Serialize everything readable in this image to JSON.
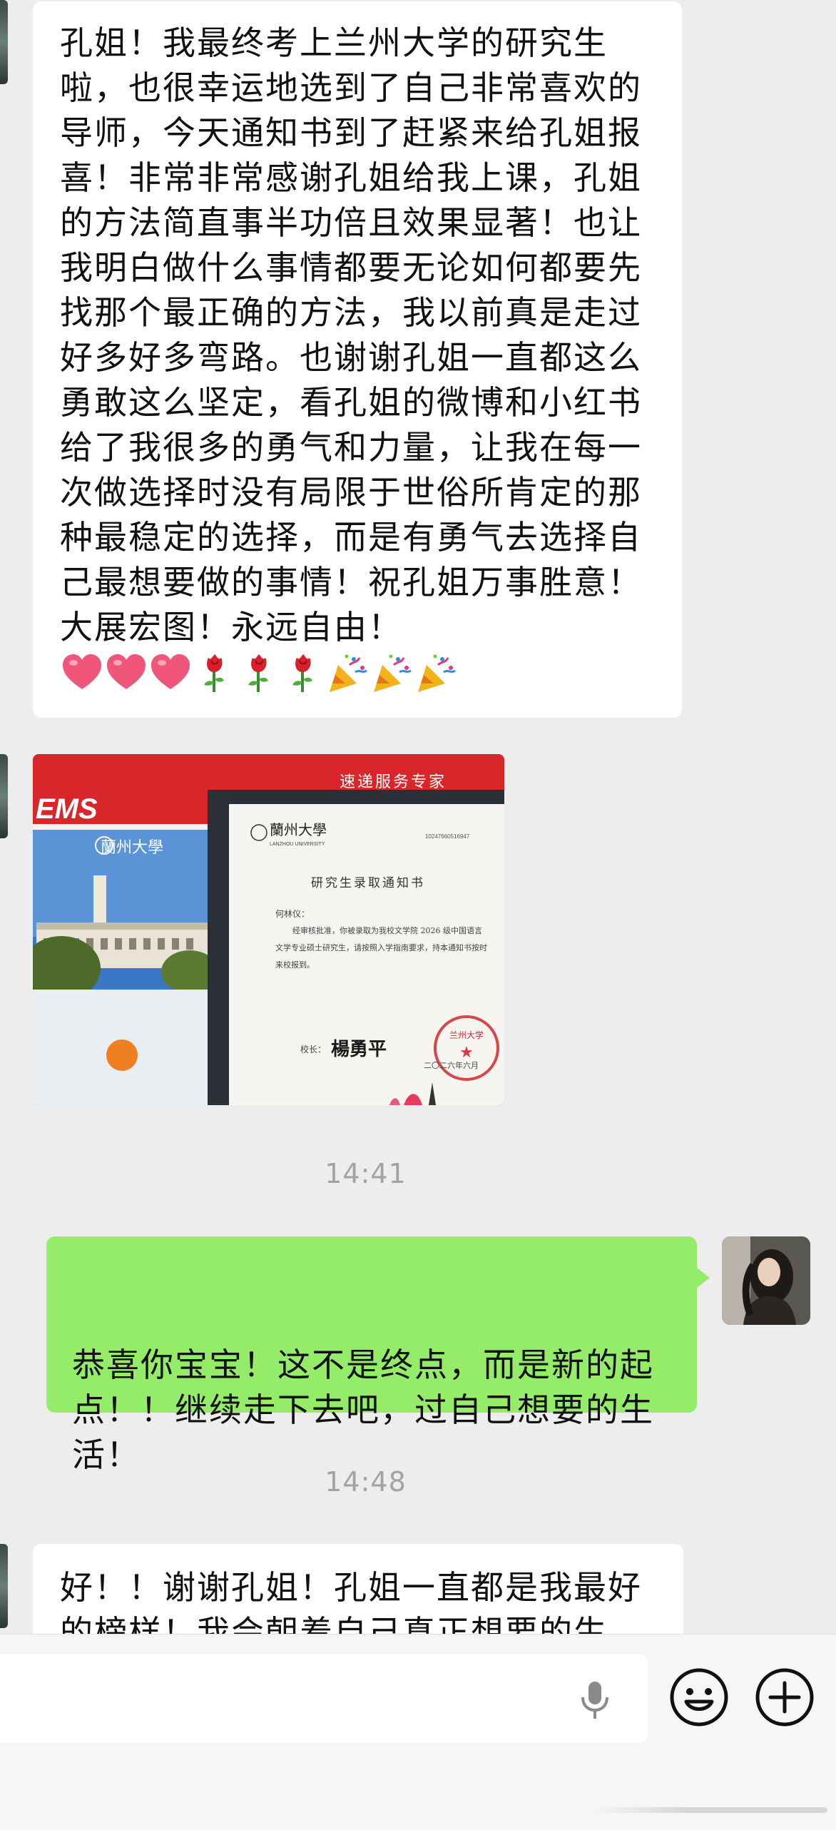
{
  "messages": [
    {
      "side": "incoming",
      "type": "text",
      "text": "孔姐！我最终考上兰州大学的研究生啦，也很幸运地选到了自己非常喜欢的导师，今天通知书到了赶紧来给孔姐报喜！非常非常感谢孔姐给我上课，孔姐的方法简直事半功倍且效果显著！也让我明白做什么事情都要无论如何都要先找那个最正确的方法，我以前真是走过好多好多弯路。也谢谢孔姐一直都这么勇敢这么坚定，看孔姐的微博和小红书给了我很多的勇气和力量，让我在每一次做选择时没有局限于世俗所肯定的那种最稳定的选择，而是有勇气去选择自己最想要做的事情！祝孔姐万事胜意！大展宏图！永远自由！",
      "emojis": [
        "heart-icon",
        "heart-icon",
        "heart-icon",
        "rose-icon",
        "rose-icon",
        "rose-icon",
        "party-popper-icon",
        "party-popper-icon",
        "party-popper-icon"
      ]
    },
    {
      "side": "incoming",
      "type": "image",
      "image": {
        "banner_text": "速递服务专家",
        "ems_logo": "EMS",
        "university_name": "蘭州大學",
        "university_name_en": "LANZHOU UNIVERSITY",
        "serial_number": "10247660516947",
        "letter_title": "研究生录取通知书",
        "recipient": "何林仪：",
        "letter_body": "经审核批准，你被录取为我校文学院 2026 级中国语言文学专业硕士研究生，请按照入学指南要求，持本通知书按时来校报到。",
        "signature_label": "校长：",
        "signature": "楊勇平",
        "letter_date": "二〇二六年六月",
        "seal_text": "兰州大学"
      }
    },
    {
      "type": "timestamp",
      "text": "14:41"
    },
    {
      "side": "outgoing",
      "type": "text",
      "text": "恭喜你宝宝！这不是终点，而是新的起点！！继续走下去吧，过自己想要的生活！"
    },
    {
      "type": "timestamp",
      "text": "14:48"
    },
    {
      "side": "incoming",
      "type": "text",
      "text": "好！！谢谢孔姐！孔姐一直都是我最好的榜样！我会朝着自己真正想要的生"
    }
  ],
  "input_bar": {
    "voice_icon": "microphone-icon",
    "emoji_icon": "smiley-icon",
    "more_icon": "plus-circle-icon"
  }
}
